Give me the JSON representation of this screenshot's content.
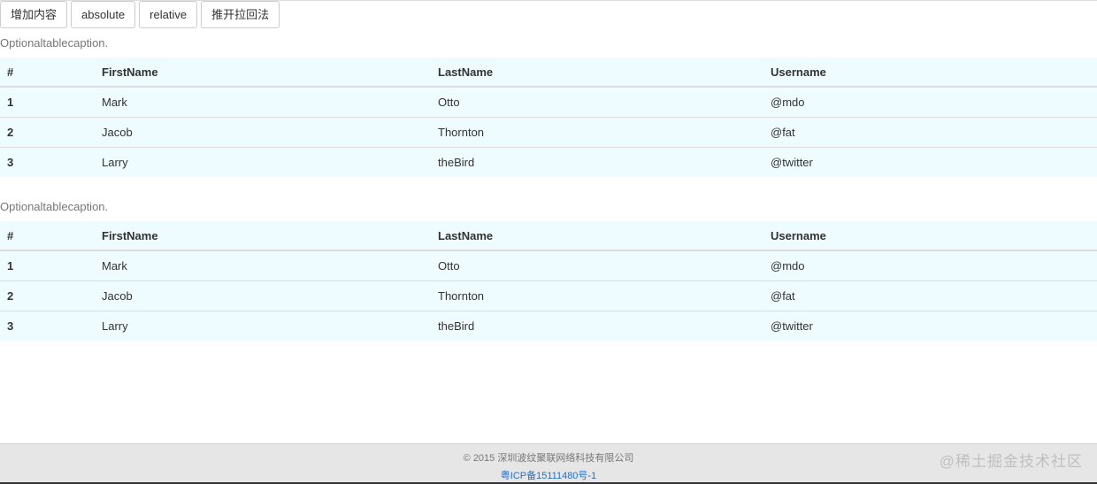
{
  "toolbar": {
    "buttons": [
      "增加内容",
      "absolute",
      "relative",
      "推开拉回法"
    ]
  },
  "tables": [
    {
      "caption": "Optionaltablecaption.",
      "headers": [
        "#",
        "FirstName",
        "LastName",
        "Username"
      ],
      "rows": [
        [
          "1",
          "Mark",
          "Otto",
          "@mdo"
        ],
        [
          "2",
          "Jacob",
          "Thornton",
          "@fat"
        ],
        [
          "3",
          "Larry",
          "theBird",
          "@twitter"
        ]
      ]
    },
    {
      "caption": "Optionaltablecaption.",
      "headers": [
        "#",
        "FirstName",
        "LastName",
        "Username"
      ],
      "rows": [
        [
          "1",
          "Mark",
          "Otto",
          "@mdo"
        ],
        [
          "2",
          "Jacob",
          "Thornton",
          "@fat"
        ],
        [
          "3",
          "Larry",
          "theBird",
          "@twitter"
        ]
      ]
    }
  ],
  "footer": {
    "copyright": "© 2015 深圳波纹聚联网络科技有限公司",
    "icp": "粤ICP备15111480号-1"
  },
  "watermark": "@稀土掘金技术社区",
  "colors": {
    "table_background": "#eefbff",
    "footer_background": "#e6e6e6",
    "link": "#2a6fc0"
  }
}
